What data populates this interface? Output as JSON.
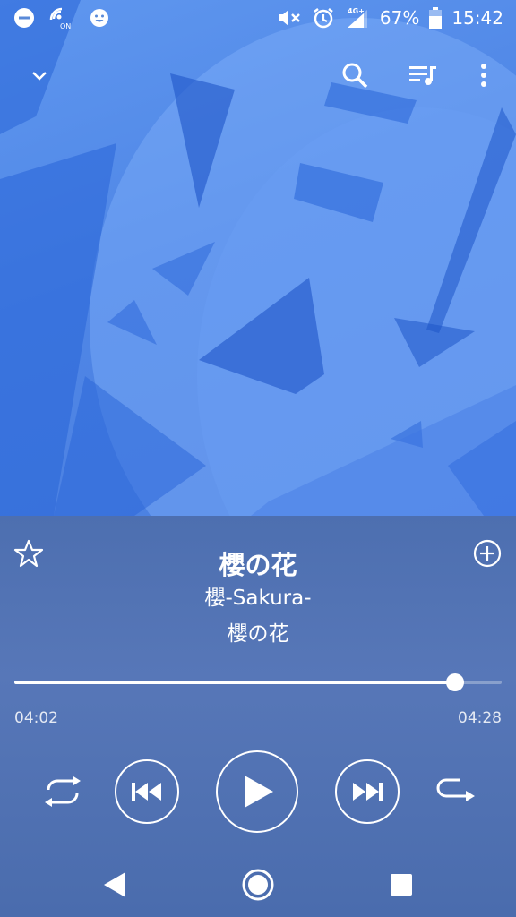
{
  "status_bar": {
    "battery_percent": "67%",
    "network_type": "4G+",
    "time": "15:42",
    "nfc_label": "ON",
    "icons": [
      "do-not-disturb-icon",
      "nfc-icon",
      "emoji-icon",
      "mute-icon",
      "alarm-icon",
      "signal-icon",
      "battery-icon"
    ]
  },
  "toolbar": {
    "icons": [
      "chevron-down-icon",
      "search-icon",
      "queue-music-icon",
      "more-vert-icon"
    ]
  },
  "now_playing": {
    "title": "櫻の花",
    "album": "櫻-Sakura-",
    "artist": "櫻の花",
    "elapsed": "04:02",
    "total": "04:28",
    "progress_fraction": 0.904
  },
  "controls": {
    "icons": [
      "shuffle-icon",
      "previous-icon",
      "play-icon",
      "next-icon",
      "repeat-icon"
    ]
  },
  "navigation": {
    "icons": [
      "back-icon",
      "home-icon",
      "recents-icon"
    ]
  },
  "colors": {
    "album_art": "#4f86e6",
    "panel": "#4d6fb0",
    "accent": "#ffffff"
  }
}
